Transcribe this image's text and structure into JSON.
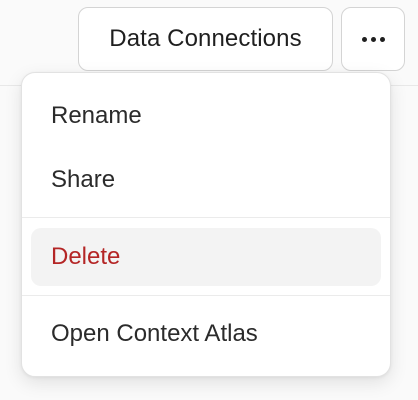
{
  "toolbar": {
    "data_connections_label": "Data Connections",
    "more_icon": "ellipsis-horizontal-icon"
  },
  "menu": {
    "items": [
      {
        "label": "Rename"
      },
      {
        "label": "Share"
      },
      {
        "label": "Delete",
        "style": "destructive",
        "color": "#b42525",
        "state": "hovered"
      },
      {
        "label": "Open Context Atlas"
      }
    ]
  },
  "colors": {
    "destructive": "#b42525",
    "hover_bg": "#f3f3f3",
    "text": "#2b2b2b"
  }
}
